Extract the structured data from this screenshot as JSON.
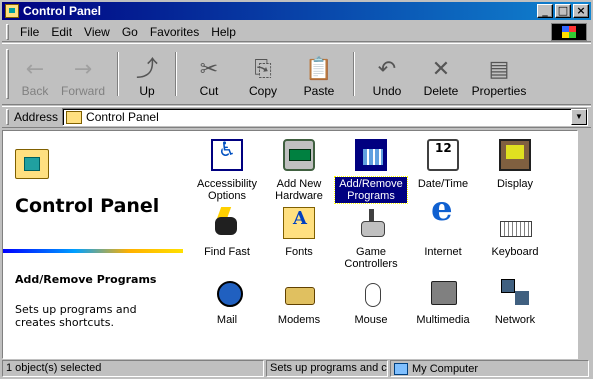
{
  "window": {
    "title": "Control Panel",
    "btn_min": "_",
    "btn_max": "□",
    "btn_close": "×"
  },
  "menu": [
    "File",
    "Edit",
    "View",
    "Go",
    "Favorites",
    "Help"
  ],
  "toolbar": [
    {
      "label": "Back",
      "icon": "back-arrow",
      "glyph": "←",
      "disabled": true
    },
    {
      "label": "Forward",
      "icon": "forward-arrow",
      "glyph": "→",
      "disabled": true
    },
    {
      "label": "Up",
      "icon": "up-folder",
      "glyph": "⤴",
      "disabled": false
    },
    {
      "label": "Cut",
      "icon": "scissors",
      "glyph": "✂",
      "disabled": false
    },
    {
      "label": "Copy",
      "icon": "copy",
      "glyph": "⎘",
      "disabled": false
    },
    {
      "label": "Paste",
      "icon": "clipboard",
      "glyph": "📋",
      "disabled": false
    },
    {
      "label": "Undo",
      "icon": "undo",
      "glyph": "↶",
      "disabled": false
    },
    {
      "label": "Delete",
      "icon": "delete",
      "glyph": "✕",
      "disabled": false
    },
    {
      "label": "Properties",
      "icon": "properties",
      "glyph": "▤",
      "disabled": false
    }
  ],
  "address": {
    "label": "Address",
    "value": "Control Panel"
  },
  "webview": {
    "title": "Control Panel",
    "selected_title": "Add/Remove Programs",
    "selected_desc": "Sets up programs and creates shortcuts."
  },
  "items": [
    {
      "label": "Accessibility Options",
      "icon": "accessibility",
      "selected": false
    },
    {
      "label": "Add New Hardware",
      "icon": "add-hardware",
      "selected": false
    },
    {
      "label": "Add/Remove Programs",
      "icon": "add-remove-programs",
      "selected": true
    },
    {
      "label": "Date/Time",
      "icon": "date-time",
      "selected": false
    },
    {
      "label": "Display",
      "icon": "display",
      "selected": false
    },
    {
      "label": "Find Fast",
      "icon": "find-fast",
      "selected": false
    },
    {
      "label": "Fonts",
      "icon": "fonts",
      "selected": false
    },
    {
      "label": "Game Controllers",
      "icon": "game-controllers",
      "selected": false
    },
    {
      "label": "Internet",
      "icon": "internet",
      "selected": false
    },
    {
      "label": "Keyboard",
      "icon": "keyboard",
      "selected": false
    },
    {
      "label": "Mail",
      "icon": "mail",
      "selected": false
    },
    {
      "label": "Modems",
      "icon": "modems",
      "selected": false
    },
    {
      "label": "Mouse",
      "icon": "mouse",
      "selected": false
    },
    {
      "label": "Multimedia",
      "icon": "multimedia",
      "selected": false
    },
    {
      "label": "Network",
      "icon": "network",
      "selected": false
    }
  ],
  "status": {
    "selection": "1 object(s) selected",
    "description": "Sets up programs and cre",
    "zone": "My Computer"
  },
  "colors": {
    "titlebar": "#000080",
    "selection": "#000080",
    "face": "#c0c0c0"
  }
}
